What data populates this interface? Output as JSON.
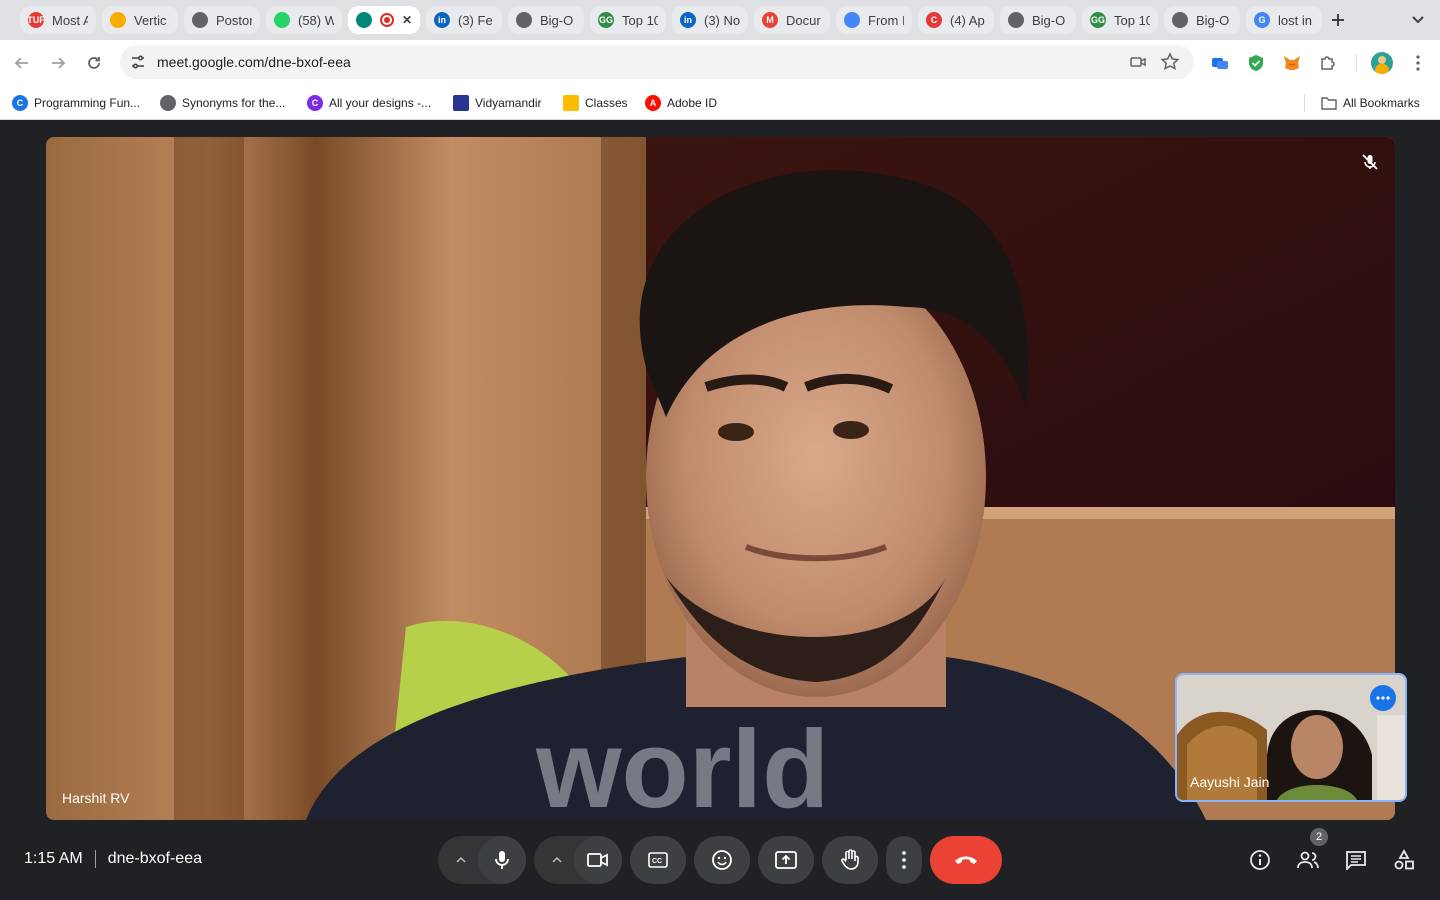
{
  "browser": {
    "tabs": [
      {
        "title": "Most A",
        "icon": "tuf-icon",
        "color": "#e53935",
        "fav_text": "TUF"
      },
      {
        "title": "Vertic",
        "icon": "chevron-logo-icon",
        "color": "#f9ab00",
        "fav_text": ""
      },
      {
        "title": "Postor",
        "icon": "openai-icon",
        "color": "#5f6368",
        "fav_text": ""
      },
      {
        "title": "(58) W",
        "icon": "whatsapp-icon",
        "color": "#25d366",
        "fav_text": ""
      },
      {
        "title": "",
        "icon": "google-meet-icon",
        "color": "#00897b",
        "fav_text": "",
        "active": true,
        "recording": true
      },
      {
        "title": "(3) Fe",
        "icon": "linkedin-icon",
        "color": "#0a66c2",
        "fav_text": "in"
      },
      {
        "title": "Big-O",
        "icon": "globe-icon",
        "color": "#5f6368",
        "fav_text": ""
      },
      {
        "title": "Top 10",
        "icon": "gfg-icon",
        "color": "#2f8d46",
        "fav_text": "GG"
      },
      {
        "title": "(3) No",
        "icon": "linkedin-icon",
        "color": "#0a66c2",
        "fav_text": "in"
      },
      {
        "title": "Docur",
        "icon": "gmail-icon",
        "color": "#ea4335",
        "fav_text": "M"
      },
      {
        "title": "From I",
        "icon": "docs-icon",
        "color": "#4285f4",
        "fav_text": ""
      },
      {
        "title": "(4) Ap",
        "icon": "c-logo-icon",
        "color": "#e53935",
        "fav_text": "C"
      },
      {
        "title": "Big-O",
        "icon": "globe-icon",
        "color": "#5f6368",
        "fav_text": ""
      },
      {
        "title": "Top 10",
        "icon": "gfg-icon",
        "color": "#2f8d46",
        "fav_text": "GG"
      },
      {
        "title": "Big-O",
        "icon": "globe-icon",
        "color": "#5f6368",
        "fav_text": ""
      },
      {
        "title": "lost in",
        "icon": "google-icon",
        "color": "#4285f4",
        "fav_text": "G"
      }
    ],
    "url": "meet.google.com/dne-bxof-eea",
    "bookmarks": [
      {
        "label": "Programming Fun...",
        "icon": "coursera-icon",
        "color": "#1a73e8",
        "fav_text": "C"
      },
      {
        "label": "Synonyms for the...",
        "icon": "globe-icon",
        "color": "#5f6368",
        "fav_text": ""
      },
      {
        "label": "All your designs -...",
        "icon": "canva-icon",
        "color": "#7d2ae8",
        "fav_text": "C"
      },
      {
        "label": "Vidyamandir",
        "icon": "vidyamandir-icon",
        "color": "#283593",
        "fav_text": ""
      },
      {
        "label": "Classes",
        "icon": "classroom-icon",
        "color": "#fbbc04",
        "fav_text": ""
      },
      {
        "label": "Adobe ID",
        "icon": "adobe-icon",
        "color": "#fa0f00",
        "fav_text": "A"
      }
    ],
    "all_bookmarks_label": "All Bookmarks"
  },
  "meet": {
    "main_participant": "Harshit RV",
    "pip_participant": "Aayushi Jain",
    "time": "1:15 AM",
    "meeting_code": "dne-bxof-eea",
    "participant_count": "2"
  },
  "colors": {
    "end_call": "#ea4335",
    "pip_border": "#8ab4f8",
    "accent": "#1a73e8"
  }
}
